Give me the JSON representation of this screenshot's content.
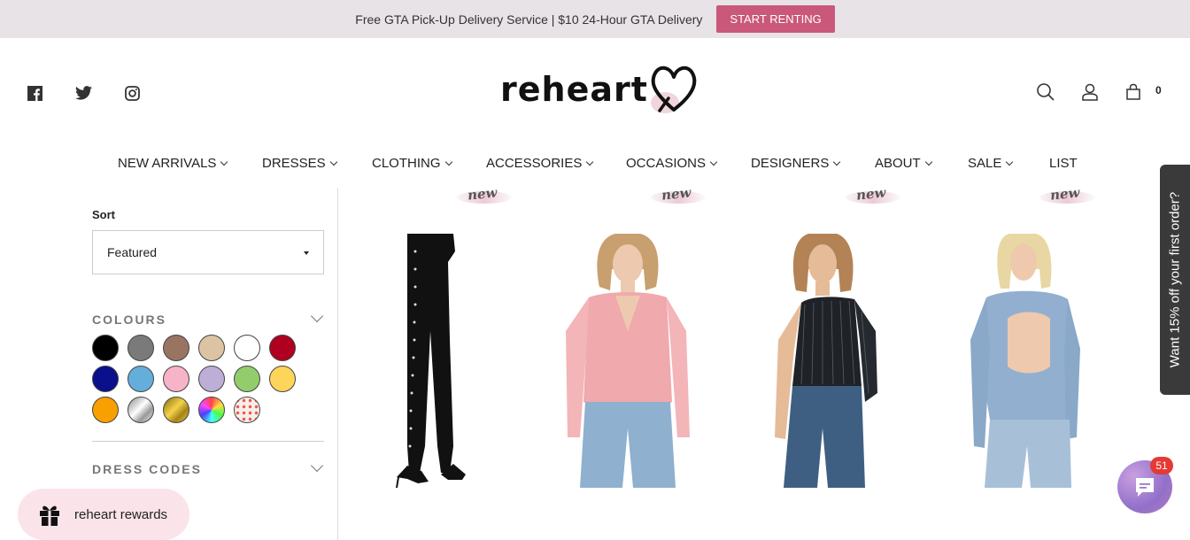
{
  "announcement": {
    "text": "Free GTA Pick-Up Delivery Service | $10 24-Hour GTA Delivery",
    "button": "START RENTING",
    "accent": "#c9587a"
  },
  "header": {
    "logo_text": "reheart",
    "social": [
      "facebook-icon",
      "twitter-icon",
      "instagram-icon"
    ],
    "cart_count": "0"
  },
  "nav": {
    "items": [
      {
        "label": "NEW ARRIVALS",
        "has_menu": true
      },
      {
        "label": "DRESSES",
        "has_menu": true
      },
      {
        "label": "CLOTHING",
        "has_menu": true
      },
      {
        "label": "ACCESSORIES",
        "has_menu": true
      },
      {
        "label": "OCCASIONS",
        "has_menu": true
      },
      {
        "label": "DESIGNERS",
        "has_menu": true
      },
      {
        "label": "ABOUT",
        "has_menu": true
      },
      {
        "label": "SALE",
        "has_menu": true
      },
      {
        "label": "LIST",
        "has_menu": false
      }
    ]
  },
  "sidebar": {
    "sort_label": "Sort",
    "sort_value": "Featured",
    "colours_title": "COLOURS",
    "dress_codes_title": "DRESS CODES",
    "colours": [
      "#000000",
      "#7a7a7a",
      "#9a7463",
      "#dcc3a4",
      "#ffffff",
      "#b00020",
      "#0a0f8c",
      "#64aedb",
      "#f7b3c7",
      "#bcaed6",
      "#93cc6b",
      "#fdd55a",
      "#f7a000",
      "silver",
      "gold",
      "rainbow",
      "pattern"
    ]
  },
  "products": [
    {
      "badge": "new",
      "desc": "black studded trousers"
    },
    {
      "badge": "new",
      "desc": "pink tie-front blouse"
    },
    {
      "badge": "new",
      "desc": "black striped one-shoulder top"
    },
    {
      "badge": "new",
      "desc": "blue open-back sweater"
    }
  ],
  "side_tab": {
    "text": "Want 15% off your first order?"
  },
  "rewards": {
    "label": "reheart rewards"
  },
  "chat": {
    "badge": "51"
  }
}
